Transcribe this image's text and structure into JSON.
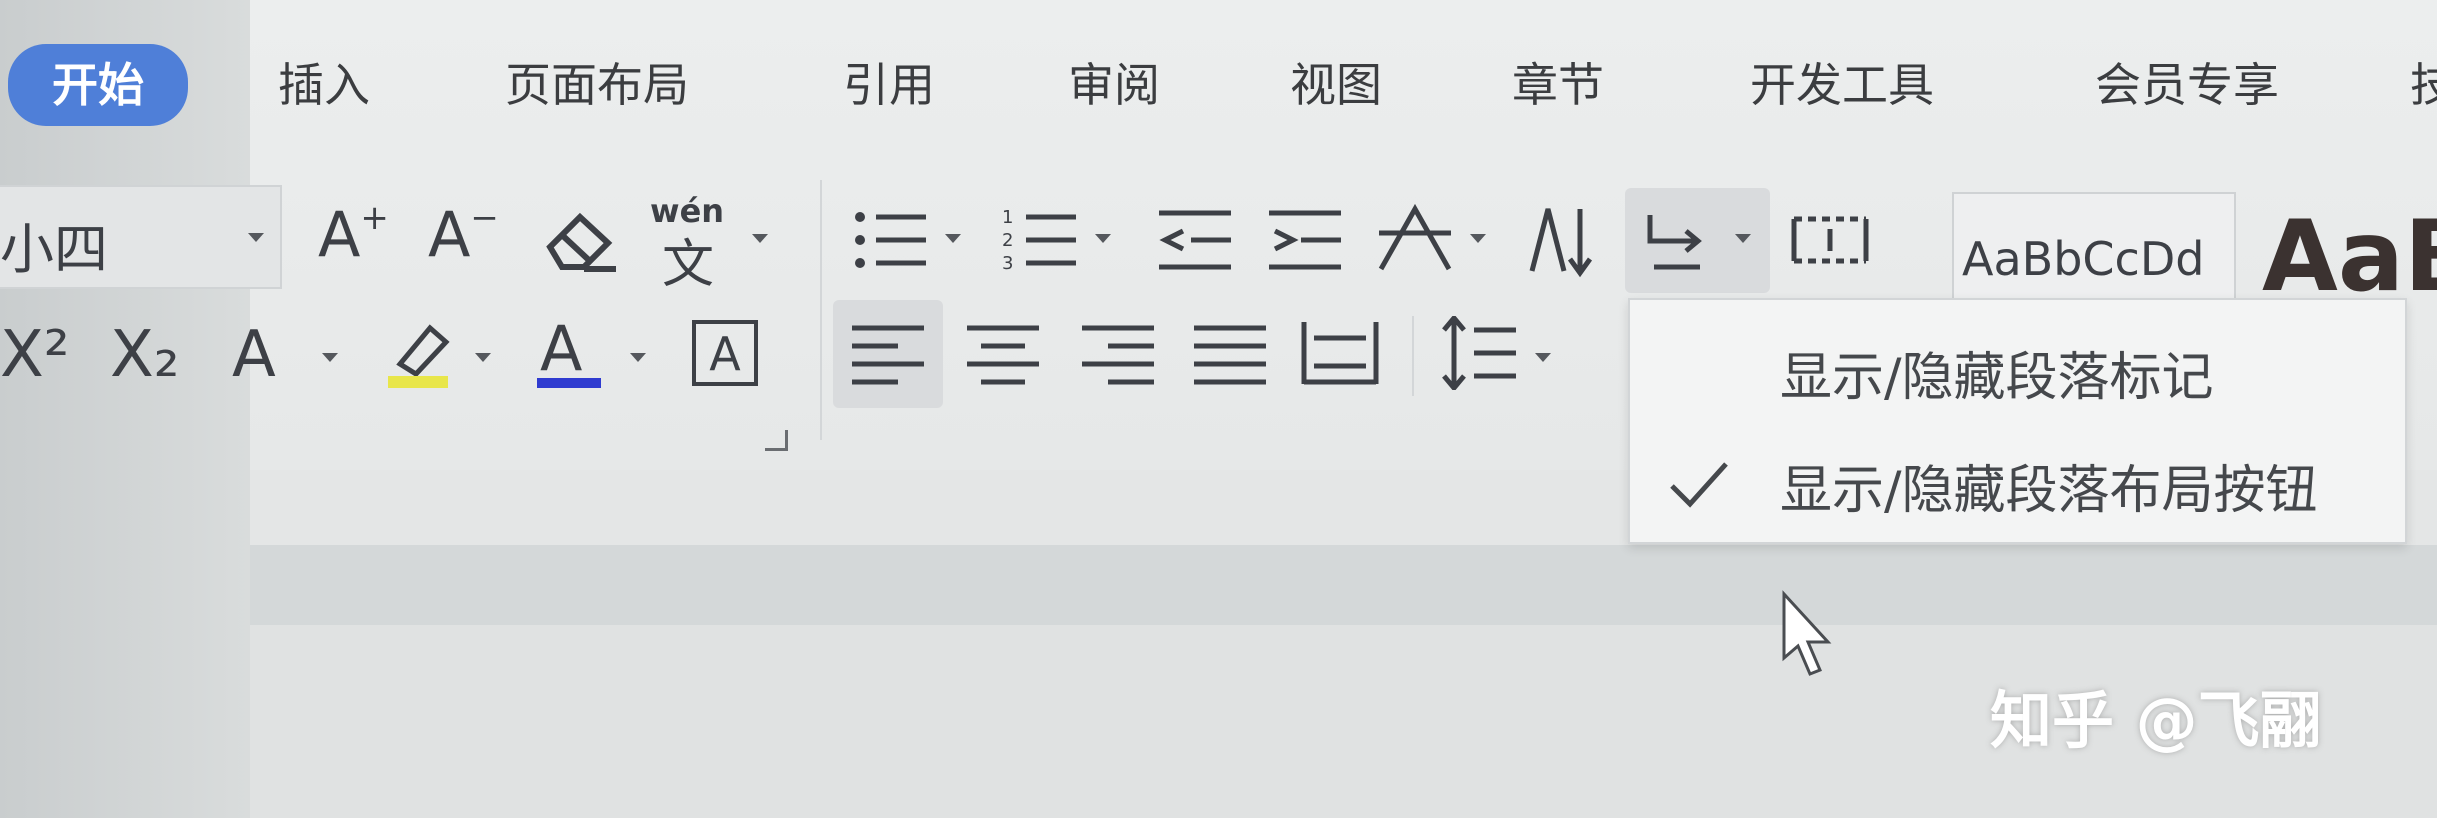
{
  "tabs": [
    "开始",
    "插入",
    "页面布局",
    "引用",
    "审阅",
    "视图",
    "章节",
    "开发工具",
    "会员专享",
    "技"
  ],
  "font_size": "小四",
  "phonetic_guide": "wén",
  "phonetic_char": "文",
  "superscript": "X²",
  "subscript": "X₂",
  "font_color_accent": "#2f3bd0",
  "highlight_accent": "#e8e64a",
  "style_gallery": {
    "normal_sample": "AaBbCcDd",
    "heading_sample": "AaB"
  },
  "dropdown": {
    "items": [
      {
        "label": "显示/隐藏段落标记",
        "checked": false
      },
      {
        "label": "显示/隐藏段落布局按钮",
        "checked": true
      }
    ]
  },
  "watermark": "知乎 @飞翮"
}
